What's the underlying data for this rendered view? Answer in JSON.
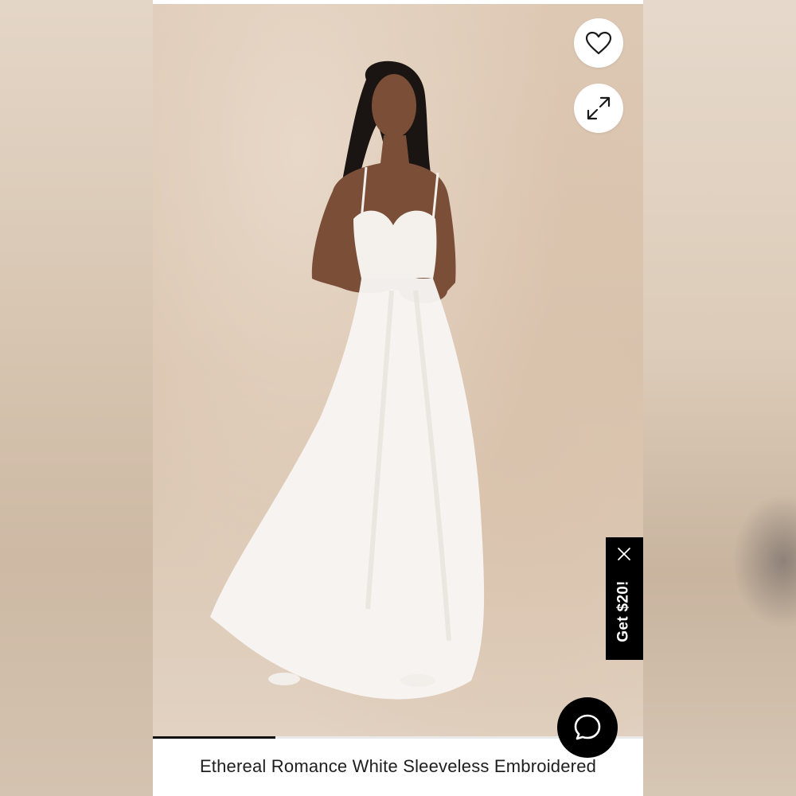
{
  "product": {
    "title": "Ethereal Romance White Sleeveless Embroidered"
  },
  "actions": {
    "favorite_icon": "heart-icon",
    "expand_icon": "expand-icon",
    "chat_icon": "chat-bubble-icon"
  },
  "promo": {
    "label": "Get $20!",
    "close_icon": "close-icon"
  },
  "gallery": {
    "progress": 0.25
  },
  "colors": {
    "accent": "#000000",
    "photo_background": "#dcc7b3",
    "dress": "#f7f5f2"
  }
}
